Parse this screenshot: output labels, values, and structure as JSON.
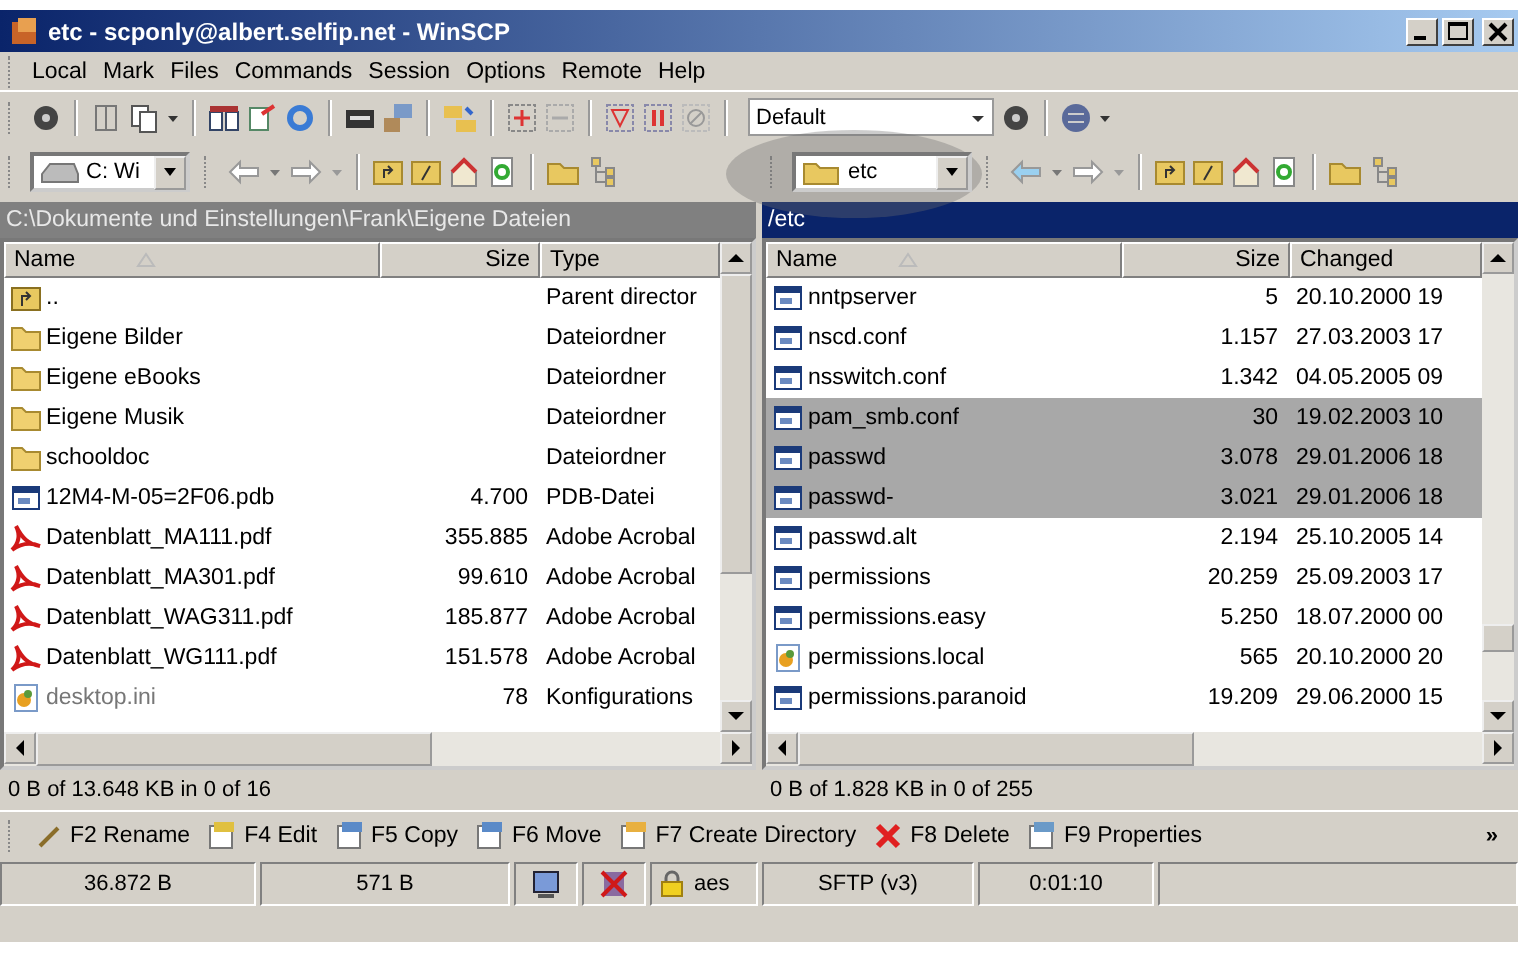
{
  "window": {
    "title": "etc - scponly@albert.selfip.net - WinSCP"
  },
  "menu": [
    "Local",
    "Mark",
    "Files",
    "Commands",
    "Session",
    "Options",
    "Remote",
    "Help"
  ],
  "toolbar": {
    "profile": "Default"
  },
  "panels": [
    {
      "active": false,
      "drive": {
        "kind": "drive",
        "label": "C: Wi"
      },
      "path": "C:\\Dokumente und Einstellungen\\Frank\\Eigene Dateien",
      "columns": [
        "Name",
        "Size",
        "Type"
      ],
      "status": "0 B of 13.648 KB in 0 of 16",
      "rows": [
        {
          "kind": "parent",
          "name": "..",
          "col3": "Parent director",
          "highlighted": false
        },
        {
          "kind": "folder",
          "name": "Eigene Bilder",
          "col3": "Dateiordner",
          "highlighted": false
        },
        {
          "kind": "folder",
          "name": "Eigene eBooks",
          "col3": "Dateiordner",
          "highlighted": false
        },
        {
          "kind": "folder",
          "name": "Eigene Musik",
          "col3": "Dateiordner",
          "highlighted": false
        },
        {
          "kind": "folder",
          "name": "schooldoc",
          "col3": "Dateiordner",
          "highlighted": false
        },
        {
          "kind": "file",
          "name": "12M4-M-05=2F06.pdb",
          "size": "4.700",
          "col3": "PDB-Datei",
          "highlighted": false
        },
        {
          "kind": "pdf",
          "name": "Datenblatt_MA111.pdf",
          "size": "355.885",
          "col3": "Adobe Acrobal",
          "highlighted": false
        },
        {
          "kind": "pdf",
          "name": "Datenblatt_MA301.pdf",
          "size": "99.610",
          "col3": "Adobe Acrobal",
          "highlighted": false
        },
        {
          "kind": "pdf",
          "name": "Datenblatt_WAG311.pdf",
          "size": "185.877",
          "col3": "Adobe Acrobal",
          "highlighted": false
        },
        {
          "kind": "pdf",
          "name": "Datenblatt_WG111.pdf",
          "size": "151.578",
          "col3": "Adobe Acrobal",
          "highlighted": false
        },
        {
          "kind": "ini",
          "name": "desktop.ini",
          "size": "78",
          "col3": "Konfigurations",
          "highlighted": false
        }
      ]
    },
    {
      "active": true,
      "drive": {
        "kind": "folder",
        "label": "etc"
      },
      "callout": true,
      "path": "/etc",
      "columns": [
        "Name",
        "Size",
        "Changed"
      ],
      "status": "0 B of 1.828 KB in 0 of 255",
      "rows": [
        {
          "kind": "file",
          "name": "nntpserver",
          "size": "5",
          "col3": "20.10.2000 19",
          "highlighted": false
        },
        {
          "kind": "file",
          "name": "nscd.conf",
          "size": "1.157",
          "col3": "27.03.2003 17",
          "highlighted": false
        },
        {
          "kind": "file",
          "name": "nsswitch.conf",
          "size": "1.342",
          "col3": "04.05.2005 09",
          "highlighted": false
        },
        {
          "kind": "file",
          "name": "pam_smb.conf",
          "size": "30",
          "col3": "19.02.2003 10",
          "highlighted": true
        },
        {
          "kind": "file",
          "name": "passwd",
          "size": "3.078",
          "col3": "29.01.2006 18",
          "highlighted": true
        },
        {
          "kind": "file",
          "name": "passwd-",
          "size": "3.021",
          "col3": "29.01.2006 18",
          "highlighted": true
        },
        {
          "kind": "file",
          "name": "passwd.alt",
          "size": "2.194",
          "col3": "25.10.2005 14",
          "highlighted": false
        },
        {
          "kind": "file",
          "name": "permissions",
          "size": "20.259",
          "col3": "25.09.2003 17",
          "highlighted": false
        },
        {
          "kind": "file",
          "name": "permissions.easy",
          "size": "5.250",
          "col3": "18.07.2000 00",
          "highlighted": false
        },
        {
          "kind": "ini",
          "name": "permissions.local",
          "size": "565",
          "col3": "20.10.2000 20",
          "highlighted": false
        },
        {
          "kind": "file",
          "name": "permissions.paranoid",
          "size": "19.209",
          "col3": "29.06.2000 15",
          "highlighted": false
        }
      ]
    }
  ],
  "commands": [
    {
      "kind": "rename",
      "label": "F2 Rename"
    },
    {
      "kind": "edit",
      "label": "F4 Edit"
    },
    {
      "kind": "copy",
      "label": "F5 Copy"
    },
    {
      "kind": "move",
      "label": "F6 Move"
    },
    {
      "kind": "mkdir",
      "label": "F7 Create Directory"
    },
    {
      "kind": "delete",
      "label": "F8 Delete"
    },
    {
      "kind": "properties",
      "label": "F9 Properties"
    }
  ],
  "commands_more": "»",
  "status_bar": {
    "sent": "36.872 B",
    "received": "571 B",
    "cipher": "aes",
    "protocol": "SFTP (v3)",
    "duration": "0:01:10"
  }
}
